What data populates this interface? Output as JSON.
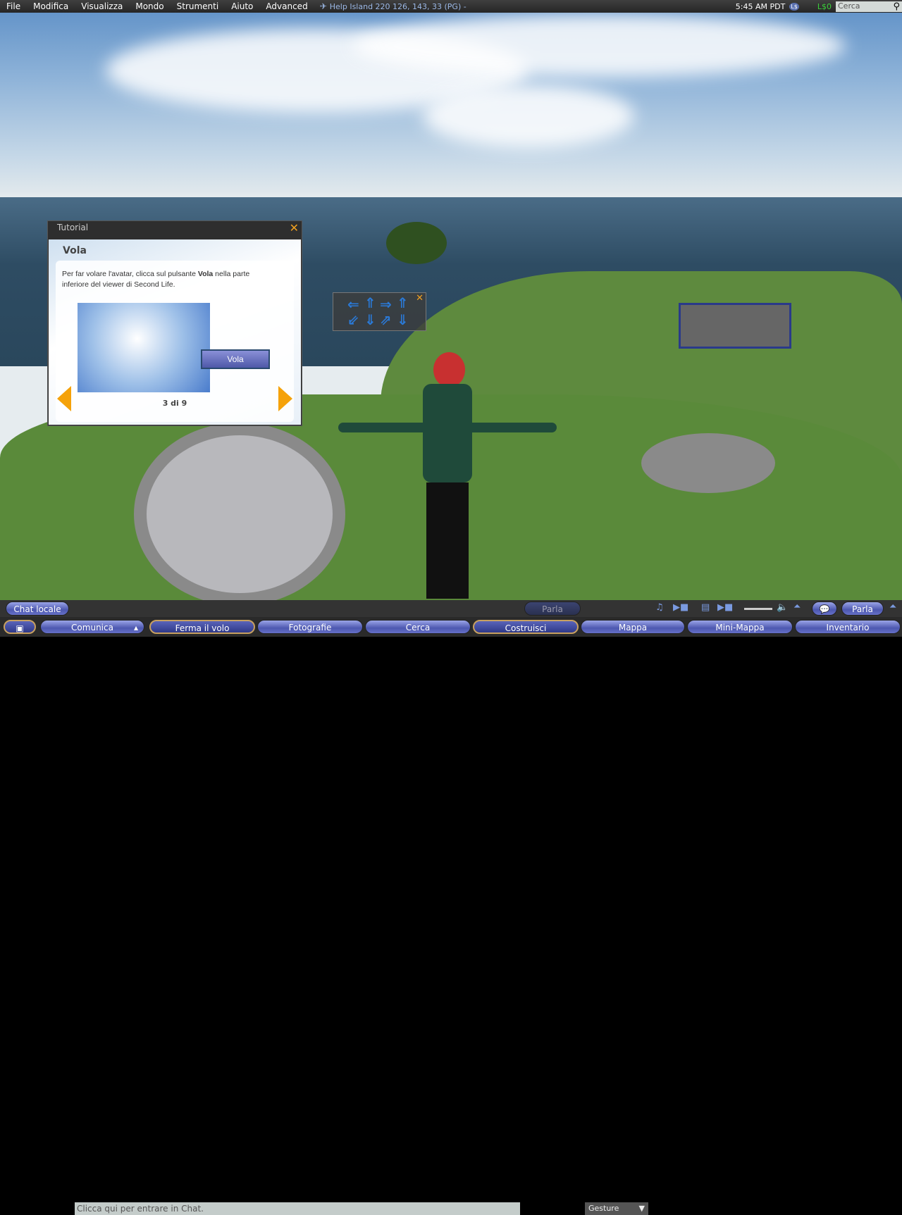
{
  "menubar": {
    "items": [
      "File",
      "Modifica",
      "Visualizza",
      "Mondo",
      "Strumenti",
      "Aiuto",
      "Advanced"
    ],
    "location": "Help Island 220 126, 143, 33 (PG) -",
    "time": "5:45 AM PDT",
    "balance": "L$0",
    "search_placeholder": "Cerca"
  },
  "tutorial": {
    "title": "Tutorial",
    "heading": "Vola",
    "text_before": "Per far volare l'avatar, clicca sul pulsante ",
    "text_bold": "Vola",
    "text_after": " nella parte inferiore del viewer di Second Life.",
    "image_button": "Vola",
    "page": "3 di 9"
  },
  "chatbar": {
    "chat_button": "Chat locale",
    "chat_placeholder": "Clicca qui per entrare in Chat.",
    "speak": "Parla",
    "gesture": "Gesture",
    "voice": "Parla"
  },
  "toolbar": {
    "buttons": [
      "Comunica",
      "Ferma il volo",
      "Fotografie",
      "Cerca",
      "Costruisci",
      "Mappa",
      "Mini-Mappa",
      "Inventario"
    ]
  },
  "colors": {
    "accent": "#f5a20a",
    "balance": "#3ad13a",
    "button": "#5a64c0"
  }
}
